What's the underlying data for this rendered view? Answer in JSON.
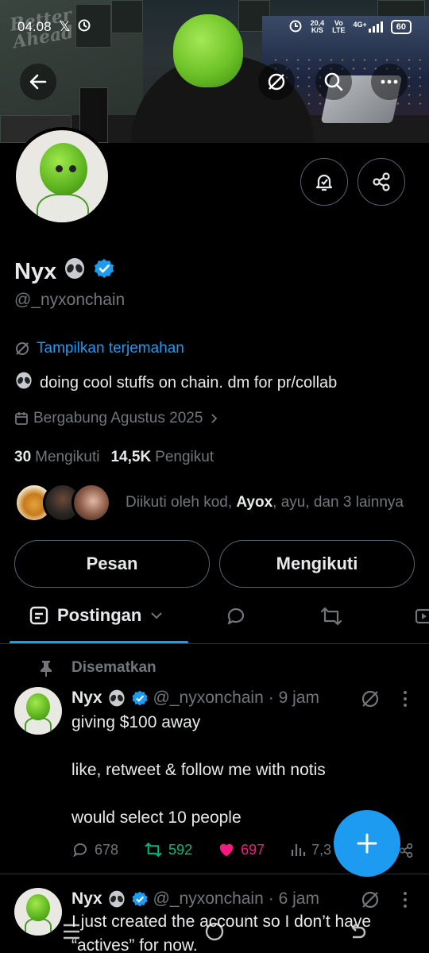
{
  "status_bar": {
    "time": "04.08",
    "speed_value": "20,4",
    "speed_unit": "K/S",
    "vo_label": "Vo",
    "lte_label": "LTE",
    "net_label": "4G+",
    "battery": "60"
  },
  "banner": {
    "text_line1": "Better",
    "text_line2": "Ahead"
  },
  "profile": {
    "name": "Nyx",
    "handle": "@_nyxonchain",
    "translate_link": "Tampilkan terjemahan",
    "bio": "doing cool stuffs on chain. dm for pr/collab",
    "joined": "Bergabung Agustus 2025",
    "following_count": "30",
    "following_label": "Mengikuti",
    "followers_count": "14,5K",
    "followers_label": "Pengikut",
    "followed_by_prefix": "Diikuti oleh kod, ",
    "followed_by_bold": "Ayox",
    "followed_by_suffix": ", ayu, dan 3 lainnya"
  },
  "actions": {
    "message_label": "Pesan",
    "following_label": "Mengikuti"
  },
  "tabs": {
    "active_label": "Postingan"
  },
  "pinned_label": "Disematkan",
  "posts": [
    {
      "name": "Nyx",
      "handle": "@_nyxonchain",
      "time": "· 9 jam",
      "line1": "giving $100 away",
      "line2": "like, retweet & follow me  with notis",
      "line3": "would select 10 people",
      "replies": "678",
      "reposts": "592",
      "likes": "697",
      "views": "7,3"
    },
    {
      "name": "Nyx",
      "handle": "@_nyxonchain",
      "time": "· 6 jam",
      "line1": "I just created the account so I don’t have",
      "line2": "“actives” for now."
    }
  ],
  "colors": {
    "accent": "#1d9bf0",
    "repost_green": "#00ba7c",
    "like_pink": "#f91880",
    "muted": "#71767b"
  },
  "icons": [
    "back-arrow-icon",
    "translate-icon",
    "search-icon",
    "more-icon",
    "notification-bell-icon",
    "share-icon",
    "verified-badge-icon",
    "alien-emoji-icon",
    "calendar-icon",
    "chevron-right-icon",
    "posts-tab-icon",
    "chevron-down-icon",
    "reply-icon",
    "repost-icon",
    "like-icon",
    "views-icon",
    "pin-icon",
    "plus-icon"
  ]
}
